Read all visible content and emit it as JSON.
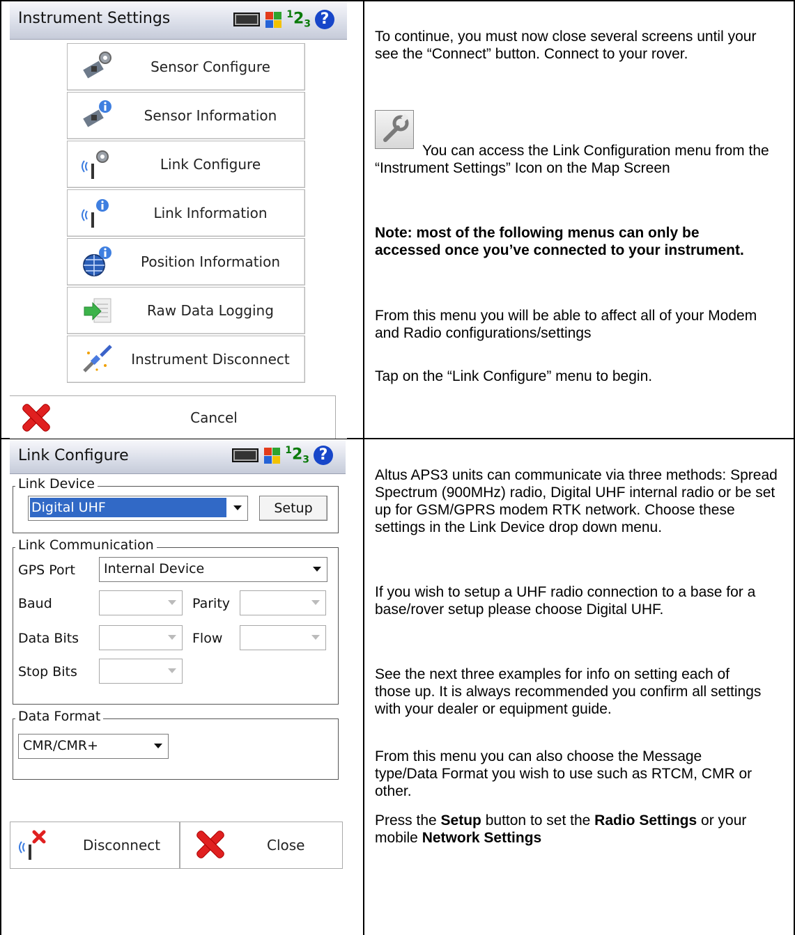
{
  "screen1": {
    "title": "Instrument Settings",
    "menu_items": [
      {
        "label": "Sensor Configure",
        "icon": "satellite-gear-icon"
      },
      {
        "label": "Sensor Information",
        "icon": "satellite-info-icon"
      },
      {
        "label": "Link Configure",
        "icon": "antenna-gear-icon"
      },
      {
        "label": "Link Information",
        "icon": "antenna-info-icon"
      },
      {
        "label": "Position Information",
        "icon": "globe-info-icon"
      },
      {
        "label": "Raw Data Logging",
        "icon": "data-logging-icon"
      },
      {
        "label": "Instrument Disconnect",
        "icon": "disconnect-plug-icon"
      }
    ],
    "cancel_label": "Cancel",
    "tray": {
      "num_1": "1",
      "num_2": "2",
      "num_3": "3",
      "help": "?"
    }
  },
  "text1": {
    "p1": "To continue, you must now close several screens until your see the “Connect” button.  Connect to your rover.",
    "p2": " You can access the Link Configuration menu from the “Instrument Settings” Icon  on the Map Screen",
    "p3": "Note: most of the following menus can only be accessed once you’ve connected to your instrument.",
    "p4": "From this menu you will be able to affect all of your Modem and Radio configurations/settings",
    "p5": "Tap on the “Link Configure” menu to begin."
  },
  "screen2": {
    "title": "Link Configure",
    "link_device_legend": "Link Device",
    "link_device_value": "Digital UHF",
    "setup_label": "Setup",
    "link_comm_legend": "Link Communication",
    "gps_port_label": "GPS Port",
    "gps_port_value": "Internal Device",
    "baud_label": "Baud",
    "parity_label": "Parity",
    "data_bits_label": "Data Bits",
    "flow_label": "Flow",
    "stop_bits_label": "Stop Bits",
    "data_format_legend": "Data Format",
    "data_format_value": "CMR/CMR+",
    "disconnect_label": "Disconnect",
    "close_label": "Close"
  },
  "text2": {
    "p1": "Altus APS3 units can communicate via three methods: Spread Spectrum (900MHz) radio, Digital UHF internal radio or be set up for GSM/GPRS modem RTK network. Choose these settings in the Link Device drop down menu.",
    "p2": "If you wish to setup a UHF radio connection to a base for a base/rover setup please choose Digital UHF.",
    "p3": "See the next three examples for info on setting each of those up. It is always recommended you confirm all settings with your dealer or equipment guide.",
    "p4": "From this menu you can also choose the Message type/Data Format you wish to use such as RTCM, CMR or other.",
    "p5_a": "Press the ",
    "p5_b": "Setup",
    "p5_c": " button to set the ",
    "p5_d": "Radio Settings",
    "p5_e": " or your mobile ",
    "p5_f": "Network Settings"
  },
  "colors": {
    "accent": "#3169c6",
    "cancel_red": "#e02020",
    "help_blue": "#1746c9"
  }
}
